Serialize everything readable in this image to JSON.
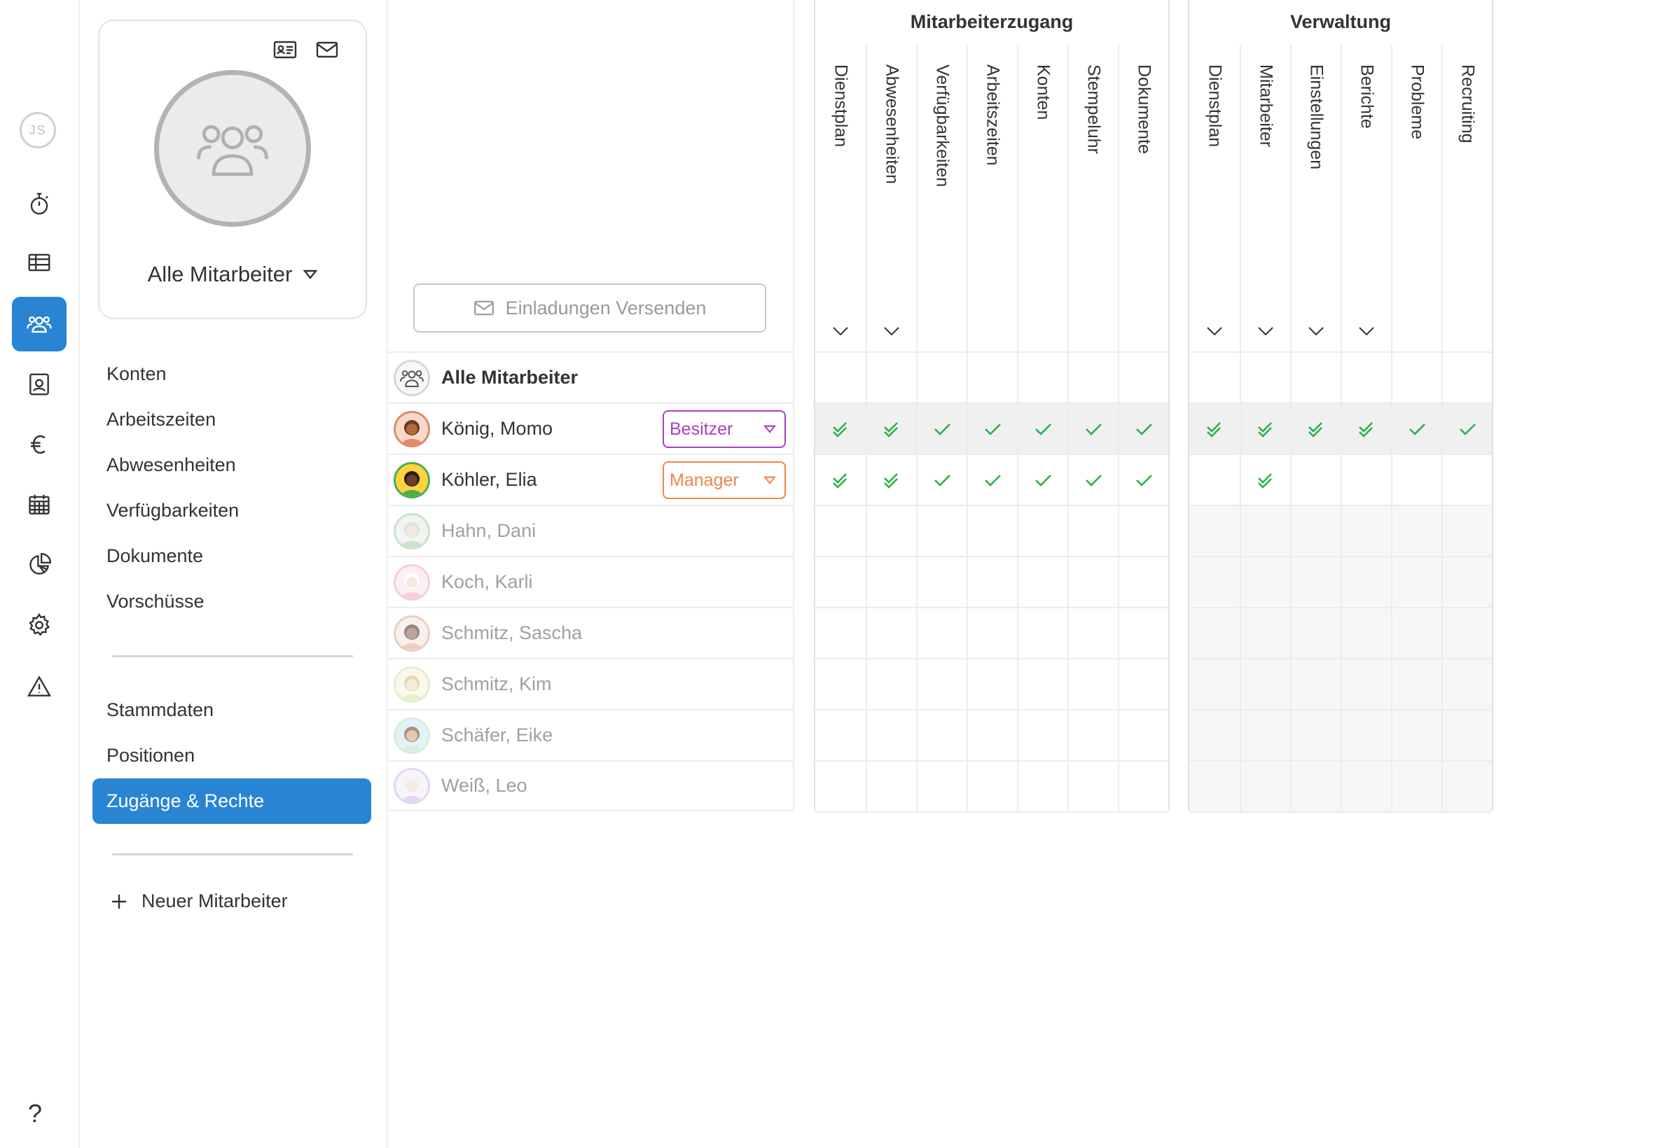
{
  "rail": {
    "user_initials": "JS",
    "items": [
      {
        "icon": "stopwatch-icon",
        "active": false
      },
      {
        "icon": "table-icon",
        "active": false
      },
      {
        "icon": "users-icon",
        "active": true
      },
      {
        "icon": "contact-card-icon",
        "active": false
      },
      {
        "icon": "euro-icon",
        "active": false
      },
      {
        "icon": "calendar-icon",
        "active": false
      },
      {
        "icon": "pie-chart-icon",
        "active": false
      },
      {
        "icon": "gear-icon",
        "active": false
      },
      {
        "icon": "warning-icon",
        "active": false
      }
    ],
    "help_label": "?"
  },
  "profile": {
    "group_name": "Alle Mitarbeiter"
  },
  "sidebar": {
    "section1": [
      "Konten",
      "Arbeitszeiten",
      "Abwesenheiten",
      "Verfügbarkeiten",
      "Dokumente",
      "Vorschüsse"
    ],
    "section2": [
      "Stammdaten",
      "Positionen",
      "Zugänge & Rechte"
    ],
    "active_item": "Zugänge & Rechte",
    "new_employee": "Neuer Mitarbeiter"
  },
  "invite_button": "Einladungen Versenden",
  "employees": {
    "all_label": "Alle Mitarbeiter",
    "rows": [
      {
        "name": "König, Momo",
        "role": "Besitzer",
        "role_type": "owner",
        "active": true
      },
      {
        "name": "Köhler, Elia",
        "role": "Manager",
        "role_type": "manager",
        "active": true
      },
      {
        "name": "Hahn, Dani",
        "role": "",
        "role_type": "",
        "active": false
      },
      {
        "name": "Koch, Karli",
        "role": "",
        "role_type": "",
        "active": false
      },
      {
        "name": "Schmitz, Sascha",
        "role": "",
        "role_type": "",
        "active": false
      },
      {
        "name": "Schmitz, Kim",
        "role": "",
        "role_type": "",
        "active": false
      },
      {
        "name": "Schäfer, Eike",
        "role": "",
        "role_type": "",
        "active": false
      },
      {
        "name": "Weiß, Leo",
        "role": "",
        "role_type": "",
        "active": false
      }
    ]
  },
  "permission_groups": [
    {
      "title": "Mitarbeiterzugang",
      "columns": [
        {
          "label": "Dienstplan",
          "expandable": true
        },
        {
          "label": "Abwesenheiten",
          "expandable": true
        },
        {
          "label": "Verfügbarkeiten",
          "expandable": false
        },
        {
          "label": "Arbeitszeiten",
          "expandable": false
        },
        {
          "label": "Konten",
          "expandable": false
        },
        {
          "label": "Stempeluhr",
          "expandable": false
        },
        {
          "label": "Dokumente",
          "expandable": false
        }
      ],
      "matrix": [
        [
          "double",
          "double",
          "single",
          "single",
          "single",
          "single",
          "single"
        ],
        [
          "double",
          "double",
          "single",
          "single",
          "single",
          "single",
          "single"
        ]
      ]
    },
    {
      "title": "Verwaltung",
      "columns": [
        {
          "label": "Dienstplan",
          "expandable": true
        },
        {
          "label": "Mitarbeiter",
          "expandable": true
        },
        {
          "label": "Einstellungen",
          "expandable": true
        },
        {
          "label": "Berichte",
          "expandable": true
        },
        {
          "label": "Probleme",
          "expandable": false
        },
        {
          "label": "Recruiting",
          "expandable": false
        }
      ],
      "matrix": [
        [
          "double",
          "double",
          "double",
          "double",
          "single",
          "single"
        ],
        [
          "",
          "double",
          "",
          "",
          "",
          ""
        ]
      ]
    }
  ],
  "colors": {
    "accent": "#2a84d4",
    "check": "#2bb24c",
    "owner": "#a93ec4",
    "manager": "#f0844a"
  }
}
